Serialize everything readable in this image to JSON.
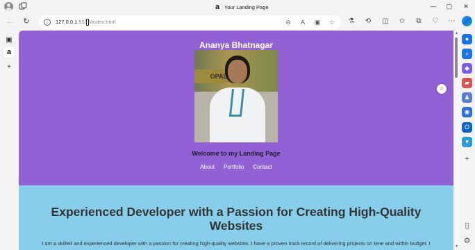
{
  "browser": {
    "tab_title": "Your Landing Page",
    "tab_favicon": "a",
    "url_host": "127.0.0.1",
    "url_rest": ":5500/index.html",
    "window_controls": {
      "minimize": "—",
      "maximize": "▢",
      "close": "✕"
    },
    "nav": {
      "back": "←",
      "refresh": "↻"
    },
    "omnibox_icons": {
      "zoom": "⊖",
      "read_aloud": "A",
      "immersive": "▣",
      "favorite": "☆"
    },
    "toolbar_icons": [
      "⚗",
      "⟲",
      "◫",
      "✩",
      "⧉",
      "♡",
      "⋯"
    ],
    "left_tabs": {
      "tab_actions": "▣",
      "amazon": "a",
      "new_tab": "+"
    },
    "right_sidebar": [
      {
        "icon": "bell-icon",
        "glyph": "●",
        "color": "#1a73e8"
      },
      {
        "icon": "search-icon",
        "glyph": "⌕",
        "color": "#1a73e8"
      },
      {
        "icon": "shopping-icon",
        "glyph": "◆",
        "color": "#7a5cf0"
      },
      {
        "icon": "tools-icon",
        "glyph": "▰",
        "color": "#d9534f"
      },
      {
        "icon": "chess-icon",
        "glyph": "♟",
        "color": "#5a7bd6"
      },
      {
        "icon": "office-icon",
        "glyph": "◉",
        "color": "#2b6fd6"
      },
      {
        "icon": "outlook-icon",
        "glyph": "O",
        "color": "#0a64c8"
      },
      {
        "icon": "drop-icon",
        "glyph": "▾",
        "color": "#2b9ad6"
      },
      {
        "icon": "add-icon",
        "glyph": "+",
        "color": "#555555"
      },
      {
        "icon": "sidebar-toggle-icon",
        "glyph": "▯",
        "color": "#555555"
      },
      {
        "icon": "settings-icon",
        "glyph": "⚙",
        "color": "#555555"
      }
    ]
  },
  "page": {
    "name": "Ananya Bhatnagar",
    "welcome": "Welcome to my Landing Page",
    "nav_links": [
      "About",
      "Portfolio",
      "Contact"
    ],
    "photo_sign_text": "OPAL",
    "headline": "Experienced Developer with a Passion for Creating High-Quality Websites",
    "intro": "I am a skilled and experienced developer with a passion for creating high-quality websites. I have a proven track record of delivering projects on time and within budget. I",
    "colors": {
      "hero_bg": "#9261d6",
      "section_bg": "#87ceeb"
    }
  }
}
